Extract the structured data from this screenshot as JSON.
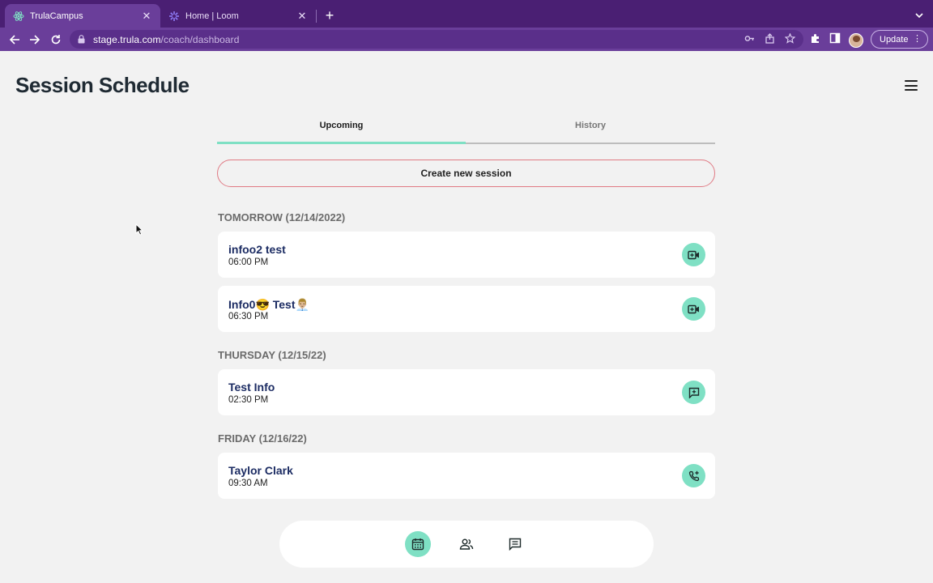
{
  "browser": {
    "tabs": [
      {
        "title": "TrulaCampus",
        "active": true
      },
      {
        "title": "Home | Loom",
        "active": false
      }
    ],
    "url_host": "stage.trula.com",
    "url_path": "/coach/dashboard",
    "update_label": "Update"
  },
  "page": {
    "title": "Session Schedule"
  },
  "tabs": {
    "upcoming": "Upcoming",
    "history": "History"
  },
  "create_button": "Create new session",
  "groups": [
    {
      "day": "TOMORROW (12/14/2022)",
      "sessions": [
        {
          "name": "infoo2 test",
          "time": "06:00 PM",
          "action_icon": "video-call-icon"
        },
        {
          "name": "Info0😎 Test👨🏼‍💼",
          "time": "06:30 PM",
          "action_icon": "video-call-icon"
        }
      ]
    },
    {
      "day": "THURSDAY (12/15/22)",
      "sessions": [
        {
          "name": "Test Info",
          "time": "02:30 PM",
          "action_icon": "chat-add-icon"
        }
      ]
    },
    {
      "day": "FRIDAY (12/16/22)",
      "sessions": [
        {
          "name": "Taylor Clark",
          "time": "09:30 AM",
          "action_icon": "phone-call-icon"
        }
      ]
    }
  ],
  "bottom_nav": [
    "calendar-icon",
    "people-icon",
    "chat-icon"
  ],
  "colors": {
    "accent": "#7fe0c4",
    "brand_purple": "#6a3e9a",
    "create_border": "#e07a84",
    "name_navy": "#1c2c63"
  }
}
